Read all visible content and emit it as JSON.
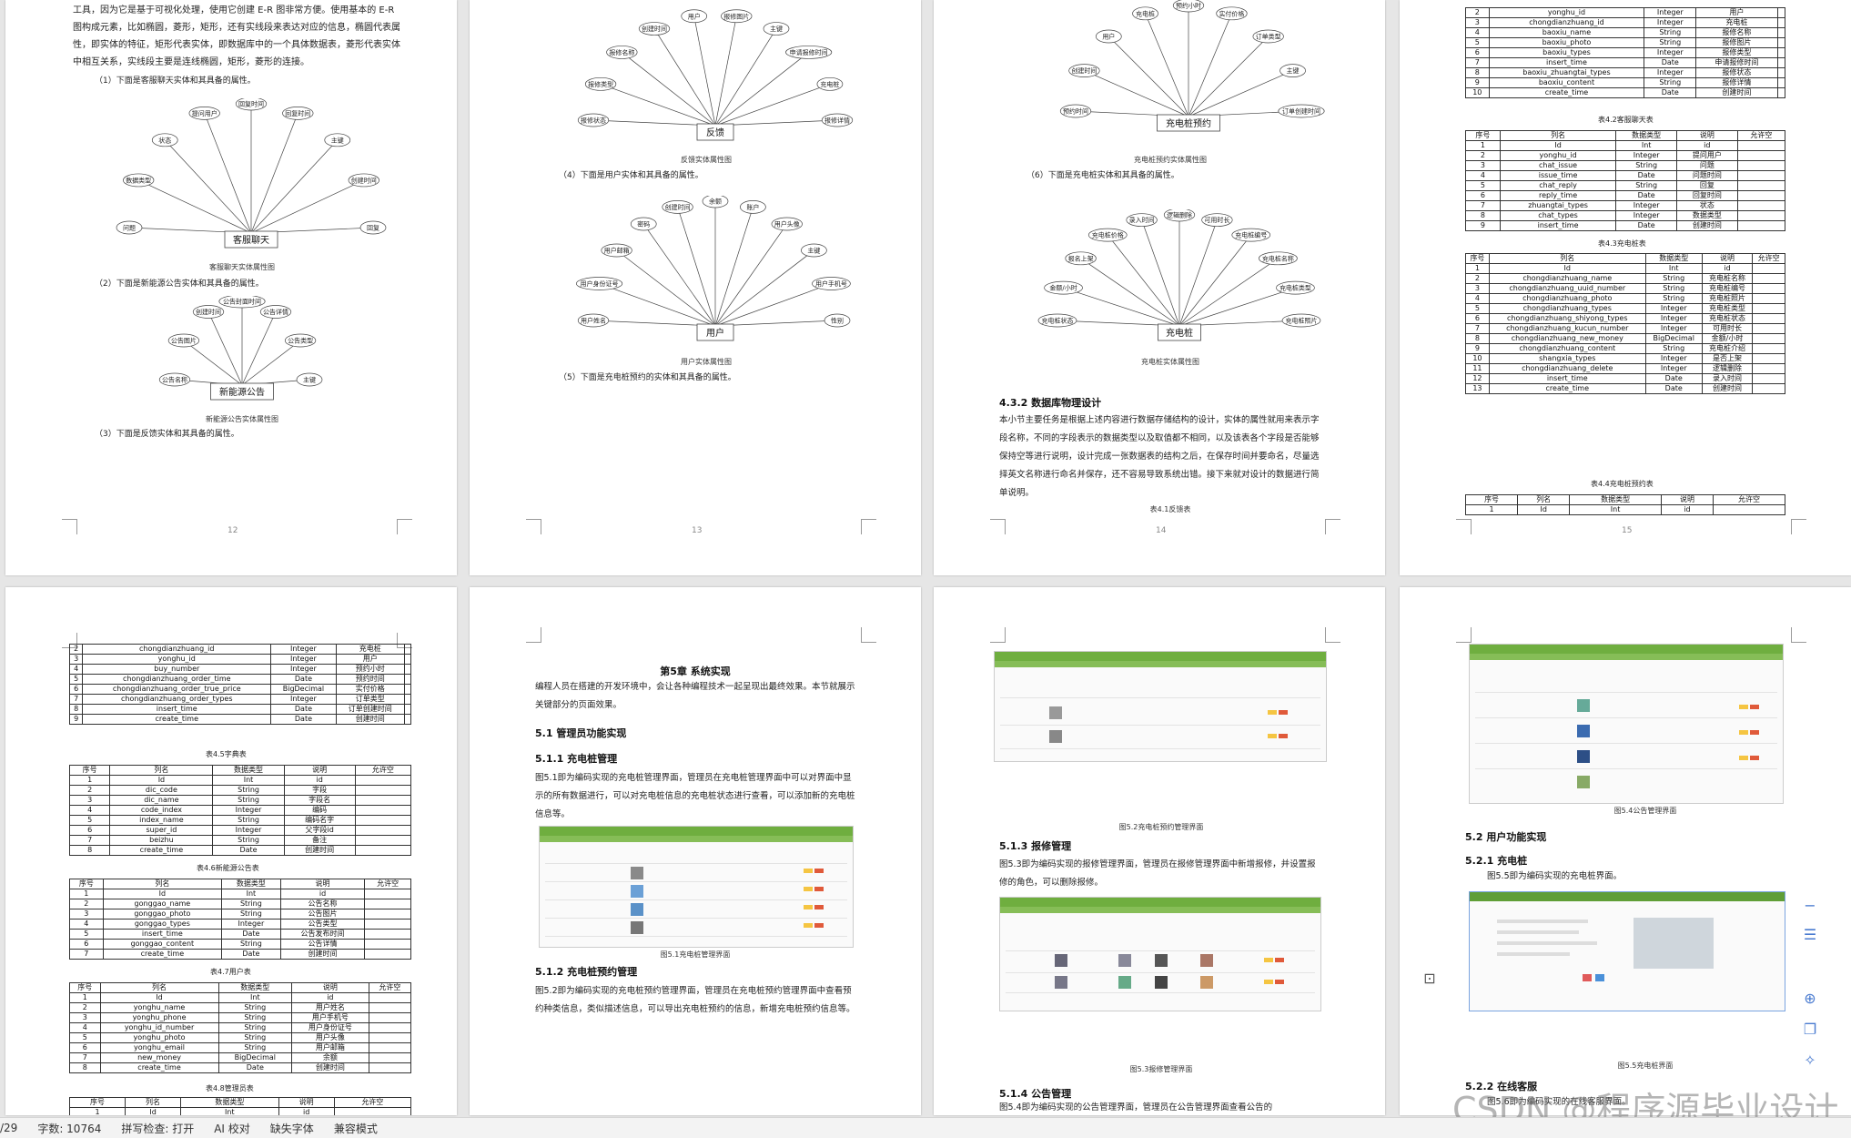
{
  "pages": {
    "p12": {
      "para": "工具，因为它是基于可视化处理，使用它创建 E-R 图非常方便。使用基本的 E-R 图构成元素，比如椭圆，菱形，矩形，还有实线段来表达对应的信息，椭圆代表属性，即实体的特征，矩形代表实体，即数据库中的一个具体数据表，菱形代表实体中相互关系，实线段主要是连线椭圆，矩形，菱形的连接。",
      "item1": "（1）下面是客服聊天实体和其具备的属性。",
      "er1_center": "客服聊天",
      "er1_attrs": [
        "问题",
        "数据类型",
        "状态",
        "提问用户",
        "回复时间",
        "回复时间",
        "主键",
        "创建时间",
        "回复"
      ],
      "er1_cap": "客服聊天实体属性图",
      "item2": "（2）下面是新能源公告实体和其具备的属性。",
      "er2_center": "新能源公告",
      "er2_attrs": [
        "公告名称",
        "公告图片",
        "创建时间",
        "公告封面时间",
        "公告详情",
        "公告类型",
        "主键"
      ],
      "er2_cap": "新能源公告实体属性图",
      "item3": "（3）下面是反馈实体和其具备的属性。",
      "num": "12"
    },
    "p13": {
      "er3_center": "反馈",
      "er3_attrs": [
        "报修状态",
        "报修类型",
        "报修名称",
        "创建时间",
        "用户",
        "报修图片",
        "主键",
        "申请报修时间",
        "充电桩",
        "报修详情"
      ],
      "er3_cap": "反馈实体属性图",
      "item4": "（4）下面是用户实体和其具备的属性。",
      "er4_center": "用户",
      "er4_attrs": [
        "用户姓名",
        "用户身份证号",
        "用户邮箱",
        "密码",
        "创建时间",
        "余额",
        "账户",
        "用户头像",
        "主键",
        "用户手机号",
        "性别"
      ],
      "er4_cap": "用户实体属性图",
      "item5": "（5）下面是充电桩预约的实体和其具备的属性。",
      "num": "13"
    },
    "p14": {
      "er5_center": "充电桩预约",
      "er5_attrs": [
        "预约时间",
        "创建时间",
        "用户",
        "充电桩",
        "预约小时",
        "实付价格",
        "订单类型",
        "主键",
        "订单创建时间"
      ],
      "er5_cap": "充电桩预约实体属性图",
      "item6": "（6）下面是充电桩实体和其具备的属性。",
      "er6_center": "充电桩",
      "er6_attrs": [
        "充电桩状态",
        "金额/小时",
        "报名上架",
        "充电桩价格",
        "录入时间",
        "逻辑删除",
        "可用时长",
        "充电桩编号",
        "充电桩名称",
        "充电桩类型",
        "充电桩照片"
      ],
      "er6_cap": "充电桩实体属性图",
      "heading": "4.3.2 数据库物理设计",
      "para": "本小节主要任务是根据上述内容进行数据存储结构的设计，实体的属性就用来表示字段名称，不同的字段表示的数据类型以及取值都不相同，以及该表各个字段是否能够保持空等进行说明，设计完成一张数据表的结构之后，在保存时间并要命名，尽量选择英文名称进行命名并保存，还不容易导致系统出错。接下来就对设计的数据进行简单说明。",
      "table_cap": "表4.1反馈表",
      "num": "14"
    },
    "p15": {
      "t1_rows": [
        [
          "2",
          "yonghu_id",
          "Integer",
          "用户"
        ],
        [
          "3",
          "chongdianzhuang_id",
          "Integer",
          "充电桩"
        ],
        [
          "4",
          "baoxiu_name",
          "String",
          "报修名称"
        ],
        [
          "5",
          "baoxiu_photo",
          "String",
          "报修图片"
        ],
        [
          "6",
          "baoxiu_types",
          "Integer",
          "报修类型"
        ],
        [
          "7",
          "insert_time",
          "Date",
          "申请报修时间"
        ],
        [
          "8",
          "baoxiu_zhuangtai_types",
          "Integer",
          "报修状态"
        ],
        [
          "9",
          "baoxiu_content",
          "String",
          "报修详情"
        ],
        [
          "10",
          "create_time",
          "Date",
          "创建时间"
        ]
      ],
      "t1_cap": "表4.2客服聊天表",
      "t2_head": [
        "序号",
        "列名",
        "数据类型",
        "说明",
        "允许空"
      ],
      "t2_rows": [
        [
          "1",
          "Id",
          "Int",
          "id",
          ""
        ],
        [
          "2",
          "yonghu_id",
          "Integer",
          "提问用户",
          ""
        ],
        [
          "3",
          "chat_issue",
          "String",
          "问题",
          ""
        ],
        [
          "4",
          "issue_time",
          "Date",
          "问题时间",
          ""
        ],
        [
          "5",
          "chat_reply",
          "String",
          "回复",
          ""
        ],
        [
          "6",
          "reply_time",
          "Date",
          "回复时间",
          ""
        ],
        [
          "7",
          "zhuangtai_types",
          "Integer",
          "状态",
          ""
        ],
        [
          "8",
          "chat_types",
          "Integer",
          "数据类型",
          ""
        ],
        [
          "9",
          "insert_time",
          "Date",
          "创建时间",
          ""
        ]
      ],
      "t2_cap": "表4.3充电桩表",
      "t3_rows": [
        [
          "1",
          "Id",
          "Int",
          "id",
          ""
        ],
        [
          "2",
          "chongdianzhuang_name",
          "String",
          "充电桩名称",
          ""
        ],
        [
          "3",
          "chongdianzhuang_uuid_number",
          "String",
          "充电桩编号",
          ""
        ],
        [
          "4",
          "chongdianzhuang_photo",
          "String",
          "充电桩照片",
          ""
        ],
        [
          "5",
          "chongdianzhuang_types",
          "Integer",
          "充电桩类型",
          ""
        ],
        [
          "6",
          "chongdianzhuang_shiyong_types",
          "Integer",
          "充电桩状态",
          ""
        ],
        [
          "7",
          "chongdianzhuang_kucun_number",
          "Integer",
          "可用时长",
          ""
        ],
        [
          "8",
          "chongdianzhuang_new_money",
          "BigDecimal",
          "金额/小时",
          ""
        ],
        [
          "9",
          "chongdianzhuang_content",
          "String",
          "充电桩介绍",
          ""
        ],
        [
          "10",
          "shangxia_types",
          "Integer",
          "是否上架",
          ""
        ],
        [
          "11",
          "chongdianzhuang_delete",
          "Integer",
          "逻辑删除",
          ""
        ],
        [
          "12",
          "insert_time",
          "Date",
          "录入时间",
          ""
        ],
        [
          "13",
          "create_time",
          "Date",
          "创建时间",
          ""
        ]
      ],
      "t3_cap": "表4.4充电桩预约表",
      "t4_rows": [
        [
          "1",
          "Id",
          "Int",
          "id",
          ""
        ]
      ],
      "num": "15"
    },
    "p16": {
      "t1_rows": [
        [
          "2",
          "chongdianzhuang_id",
          "Integer",
          "充电桩"
        ],
        [
          "3",
          "yonghu_id",
          "Integer",
          "用户"
        ],
        [
          "4",
          "buy_number",
          "Integer",
          "预约小时"
        ],
        [
          "5",
          "chongdianzhuang_order_time",
          "Date",
          "预约时间"
        ],
        [
          "6",
          "chongdianzhuang_order_true_price",
          "BigDecimal",
          "实付价格"
        ],
        [
          "7",
          "chongdianzhuang_order_types",
          "Integer",
          "订单类型"
        ],
        [
          "8",
          "insert_time",
          "Date",
          "订单创建时间"
        ],
        [
          "9",
          "create_time",
          "Date",
          "创建时间"
        ]
      ],
      "t1_cap": "表4.5字典表",
      "t2_rows": [
        [
          "1",
          "Id",
          "Int",
          "id"
        ],
        [
          "2",
          "dic_code",
          "String",
          "字段"
        ],
        [
          "3",
          "dic_name",
          "String",
          "字段名"
        ],
        [
          "4",
          "code_index",
          "Integer",
          "编码"
        ],
        [
          "5",
          "index_name",
          "String",
          "编码名字"
        ],
        [
          "6",
          "super_id",
          "Integer",
          "父字段id"
        ],
        [
          "7",
          "beizhu",
          "String",
          "备注"
        ],
        [
          "8",
          "create_time",
          "Date",
          "创建时间"
        ]
      ],
      "t2_cap": "表4.6新能源公告表",
      "t3_rows": [
        [
          "1",
          "Id",
          "Int",
          "id"
        ],
        [
          "2",
          "gonggao_name",
          "String",
          "公告名称"
        ],
        [
          "3",
          "gonggao_photo",
          "String",
          "公告图片"
        ],
        [
          "4",
          "gonggao_types",
          "Integer",
          "公告类型"
        ],
        [
          "5",
          "insert_time",
          "Date",
          "公告发布时间"
        ],
        [
          "6",
          "gonggao_content",
          "String",
          "公告详情"
        ],
        [
          "7",
          "create_time",
          "Date",
          "创建时间"
        ]
      ],
      "t3_cap": "表4.7用户表",
      "t4_rows": [
        [
          "1",
          "Id",
          "Int",
          "id"
        ],
        [
          "2",
          "yonghu_name",
          "String",
          "用户姓名"
        ],
        [
          "3",
          "yonghu_phone",
          "String",
          "用户手机号"
        ],
        [
          "4",
          "yonghu_id_number",
          "String",
          "用户身份证号"
        ],
        [
          "5",
          "yonghu_photo",
          "String",
          "用户头像"
        ],
        [
          "6",
          "yonghu_email",
          "String",
          "用户邮箱"
        ],
        [
          "7",
          "new_money",
          "BigDecimal",
          "余额"
        ],
        [
          "8",
          "create_time",
          "Date",
          "创建时间"
        ]
      ],
      "t4_cap": "表4.8管理员表",
      "t5_rows": [
        [
          "1",
          "Id",
          "Int",
          "id"
        ]
      ]
    },
    "p17": {
      "chapter": "第5章 系统实现",
      "intro": "编程人员在搭建的开发环境中，会让各种编程技术一起呈现出最终效果。本节就展示关键部分的页面效果。",
      "s51": "5.1 管理员功能实现",
      "s511": "5.1.1 充电桩管理",
      "p511": "图5.1即为编码实现的充电桩管理界面，管理员在充电桩管理界面中可以对界面中显示的所有数据进行，可以对充电桩信息的充电桩状态进行查看，可以添加新的充电桩信息等。",
      "fig51": "图5.1充电桩管理界面",
      "s512": "5.1.2 充电桩预约管理",
      "p512": "图5.2即为编码实现的充电桩预约管理界面，管理员在充电桩预约管理界面中查看预约种类信息，类似描述信息，可以导出充电桩预约的信息，新增充电桩预约信息等。"
    },
    "p18": {
      "fig52": "图5.2充电桩预约管理界面",
      "s513": "5.1.3 报修管理",
      "p513": "图5.3即为编码实现的报修管理界面，管理员在报修管理界面中新增报修，并设置报修的角色，可以删除报修。",
      "fig53": "图5.3报修管理界面",
      "s514": "5.1.4 公告管理",
      "p514": "图5.4即为编码实现的公告管理界面，管理员在公告管理界面查看公告的"
    },
    "p19": {
      "fig54": "图5.4公告管理界面",
      "s52": "5.2 用户功能实现",
      "s521": "5.2.1 充电桩",
      "p521": "图5.5即为编码实现的充电桩界面。",
      "fig55": "图5.5充电桩界面",
      "s522": "5.2.2 在线客服",
      "p522": "图5.6即为编码实现的在线客服界面。"
    }
  },
  "statusbar": {
    "pages": "/29",
    "words": "字数: 10764",
    "spell": "拼写检查: 打开",
    "ai": "AI 校对",
    "font": "缺失字体",
    "mode": "兼容模式"
  },
  "watermark": "CSDN @程序源毕业设计"
}
